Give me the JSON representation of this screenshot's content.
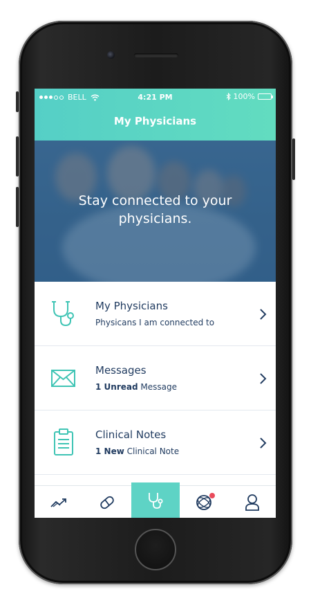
{
  "status_bar": {
    "carrier": "BELL",
    "time": "4:21 PM",
    "battery": "100%"
  },
  "nav": {
    "title": "My Physicians"
  },
  "hero": {
    "text": "Stay connected to your physicians."
  },
  "items": [
    {
      "title": "My Physicians",
      "sub_bold": "",
      "sub_text": "Physicans I am connected to",
      "icon": "stethoscope-icon"
    },
    {
      "title": "Messages",
      "sub_bold": "1 Unread",
      "sub_text": " Message",
      "icon": "envelope-icon"
    },
    {
      "title": "Clinical Notes",
      "sub_bold": "1 New",
      "sub_text": " Clinical Note",
      "icon": "clipboard-icon"
    }
  ],
  "tabs": [
    {
      "name": "trends",
      "icon": "trend-chart-icon"
    },
    {
      "name": "medications",
      "icon": "pill-icon"
    },
    {
      "name": "physicians",
      "icon": "stethoscope-icon",
      "active": true
    },
    {
      "name": "community",
      "icon": "network-icon",
      "badge": true
    },
    {
      "name": "profile",
      "icon": "profile-icon"
    }
  ],
  "colors": {
    "accent": "#5ed3c5",
    "header_start": "#55cfc6",
    "header_end": "#62dcc0",
    "text_dark": "#1f3a5f",
    "badge": "#e94b5b"
  }
}
